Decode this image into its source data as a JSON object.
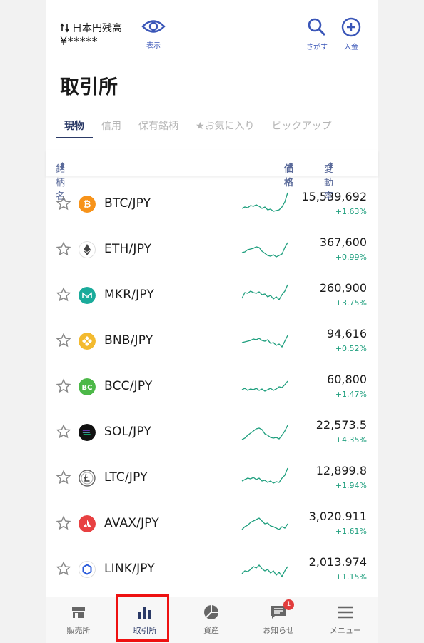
{
  "header": {
    "balance_label": "日本円残高",
    "balance_value": "¥*****",
    "show_label": "表示",
    "search_label": "さがす",
    "deposit_label": "入金"
  },
  "page_title": "取引所",
  "tabs": [
    {
      "label": "現物",
      "active": true
    },
    {
      "label": "信用",
      "active": false
    },
    {
      "label": "保有銘柄",
      "active": false
    },
    {
      "label": "★お気に入り",
      "active": false
    },
    {
      "label": "ピックアップ",
      "active": false
    }
  ],
  "columns": {
    "name": "銘柄名",
    "price": "価格",
    "change": "変動率"
  },
  "rows": [
    {
      "pair": "BTC/JPY",
      "price": "15,539,692",
      "change": "+1.63%",
      "icon": "btc-icon",
      "color": "#f7931a"
    },
    {
      "pair": "ETH/JPY",
      "price": "367,600",
      "change": "+0.99%",
      "icon": "eth-icon",
      "color": "#ffffff"
    },
    {
      "pair": "MKR/JPY",
      "price": "260,900",
      "change": "+3.75%",
      "icon": "mkr-icon",
      "color": "#1aab9b"
    },
    {
      "pair": "BNB/JPY",
      "price": "94,616",
      "change": "+0.52%",
      "icon": "bnb-icon",
      "color": "#f3ba2f"
    },
    {
      "pair": "BCC/JPY",
      "price": "60,800",
      "change": "+1.47%",
      "icon": "bcc-icon",
      "color": "#4cb848"
    },
    {
      "pair": "SOL/JPY",
      "price": "22,573.5",
      "change": "+4.35%",
      "icon": "sol-icon",
      "color": "#111111"
    },
    {
      "pair": "LTC/JPY",
      "price": "12,899.8",
      "change": "+1.94%",
      "icon": "ltc-icon",
      "color": "#ffffff"
    },
    {
      "pair": "AVAX/JPY",
      "price": "3,020.911",
      "change": "+1.61%",
      "icon": "avax-icon",
      "color": "#e84142"
    },
    {
      "pair": "LINK/JPY",
      "price": "2,013.974",
      "change": "+1.15%",
      "icon": "link-icon",
      "color": "#ffffff"
    }
  ],
  "nav": [
    {
      "label": "販売所",
      "icon": "store-icon"
    },
    {
      "label": "取引所",
      "icon": "bar-chart-icon",
      "active": true
    },
    {
      "label": "資産",
      "icon": "pie-chart-icon"
    },
    {
      "label": "お知らせ",
      "icon": "message-icon",
      "badge": "1"
    },
    {
      "label": "メニュー",
      "icon": "menu-icon"
    }
  ],
  "colors": {
    "accent": "#2b3a67",
    "link": "#3a56b8",
    "positive": "#1f9f7e",
    "highlight": "#ee1111"
  }
}
